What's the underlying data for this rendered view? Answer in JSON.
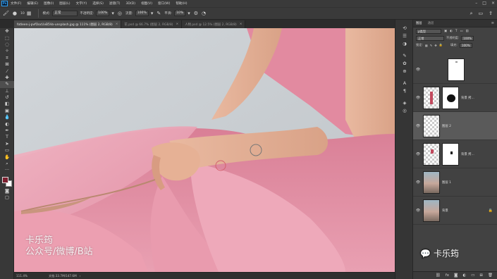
{
  "app": {
    "logo": "Ps"
  },
  "menu": [
    "文件(F)",
    "编辑(E)",
    "图像(I)",
    "图层(L)",
    "文字(Y)",
    "选择(S)",
    "滤镜(T)",
    "3D(D)",
    "视图(V)",
    "窗口(W)",
    "帮助(H)"
  ],
  "options": {
    "brush_size": "10",
    "mode_label": "模式:",
    "mode_value": "正常",
    "opacity_label": "不透明度:",
    "opacity_value": "100%",
    "flow_label": "流量:",
    "flow_value": "100%",
    "smooth_label": "平滑:",
    "smooth_value": "10%"
  },
  "tabs": [
    {
      "label": "fotleen-j-pvfOocUvB5Vo-unsplash.jpg @ 111% (图层 2, RGB/8)",
      "close": "×",
      "active": true
    },
    {
      "label": "花.psd @ 66.7% (图层 2, RGB/8)",
      "close": "×",
      "active": false
    },
    {
      "label": "人物.psd @ 12.5% (图层 2, RGB/8)",
      "close": "×",
      "active": false
    }
  ],
  "canvas": {
    "watermark_line1": "卡乐筠",
    "watermark_line2": "公众号/微博/B站"
  },
  "status": {
    "zoom": "111.4%",
    "doc": "文档:33.7M/147.6M"
  },
  "layers_panel": {
    "tab_layers": "图层",
    "tab_channels": "通道",
    "menu": "≡",
    "filter_label": "ρ类型",
    "blend_mode": "正常",
    "opacity_label": "不透明度:",
    "opacity_value": "100%",
    "lock_label": "锁定:",
    "fill_label": "填充:",
    "fill_value": "100%",
    "layers": [
      {
        "name": "",
        "kind": "mask-top"
      },
      {
        "name": "背景 拷...",
        "kind": "figure-mask"
      },
      {
        "name": "图层 2",
        "kind": "empty",
        "selected": true
      },
      {
        "name": "背景 拷...",
        "kind": "figure-mask2"
      },
      {
        "name": "图层 1",
        "kind": "photo"
      },
      {
        "name": "背景",
        "kind": "photo",
        "locked": true
      }
    ]
  },
  "wechat": {
    "label": "卡乐筠"
  },
  "colors": {
    "foreground": "#7d2030",
    "background": "#ffffff",
    "dress_pink": "#e88fa4",
    "skin": "#e8b69c"
  }
}
